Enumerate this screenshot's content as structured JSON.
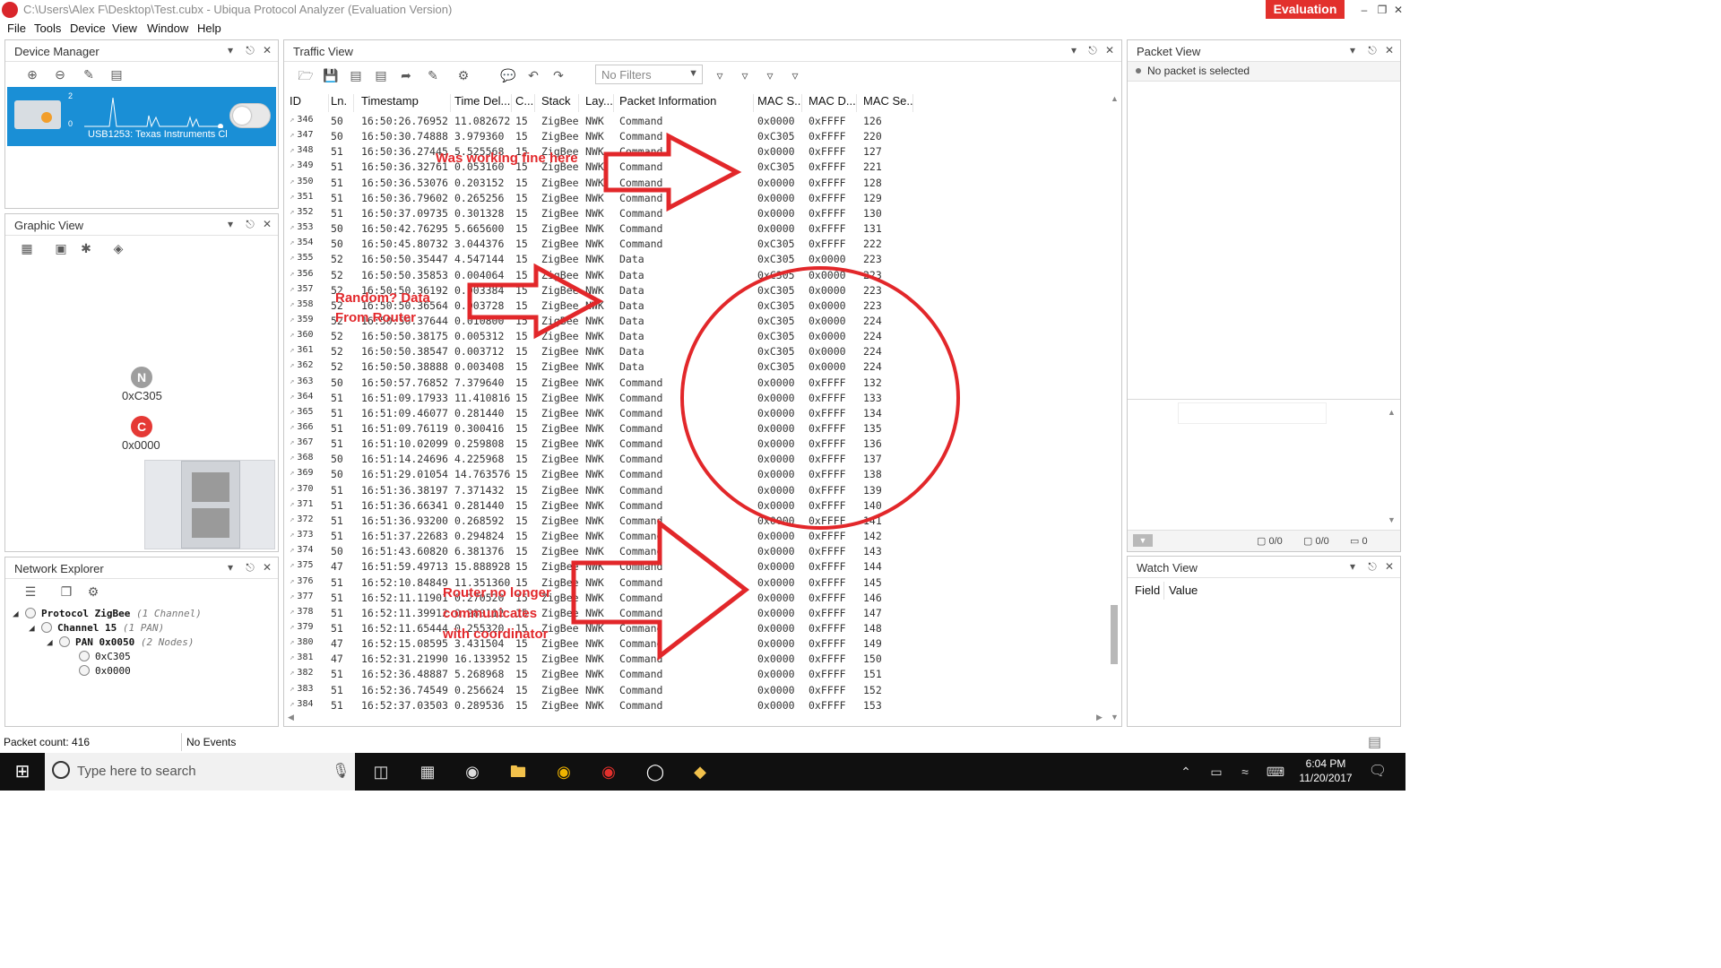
{
  "window": {
    "title": "C:\\Users\\Alex F\\Desktop\\Test.cubx - Ubiqua Protocol Analyzer (Evaluation Version)",
    "evaluation_badge": "Evaluation",
    "minimize": "–",
    "restore": "❐",
    "close": "✕"
  },
  "menu": [
    "File",
    "Tools",
    "Device",
    "View",
    "Window",
    "Help"
  ],
  "device_manager": {
    "title": "Device Manager",
    "device_name": "USB1253: Texas Instruments Cl",
    "sparkline_top": "2",
    "sparkline_bottom": "0"
  },
  "graphic_view": {
    "title": "Graphic View",
    "nodes": [
      {
        "letter": "N",
        "address": "0xC305",
        "color": "#9e9e9e"
      },
      {
        "letter": "C",
        "address": "0x0000",
        "color": "#e53935"
      }
    ]
  },
  "network_explorer": {
    "title": "Network Explorer",
    "protocol": "Protocol ZigBee",
    "protocol_detail": "(1 Channel)",
    "channel": "Channel 15",
    "channel_detail": "(1 PAN)",
    "pan": "PAN 0x0050",
    "pan_detail": "(2 Nodes)",
    "devices": [
      "0xC305",
      "0x0000"
    ]
  },
  "traffic_view": {
    "title": "Traffic View",
    "filter_placeholder": "No Filters",
    "columns": [
      "ID",
      "Ln.",
      "Timestamp",
      "Time Del...",
      "C...",
      "Stack",
      "Lay...",
      "Packet Information",
      "MAC S...",
      "MAC D...",
      "MAC Se..."
    ],
    "rows": [
      [
        "346",
        "50",
        "16:50:26.76952",
        "11.082672",
        "15",
        "ZigBee",
        "NWK",
        "Command",
        "0x0000",
        "0xFFFF",
        "126"
      ],
      [
        "347",
        "50",
        "16:50:30.74888",
        "3.979360",
        "15",
        "ZigBee",
        "NWK",
        "Command",
        "0xC305",
        "0xFFFF",
        "220"
      ],
      [
        "348",
        "51",
        "16:50:36.27445",
        "5.525568",
        "15",
        "ZigBee",
        "NWK",
        "Command",
        "0x0000",
        "0xFFFF",
        "127"
      ],
      [
        "349",
        "51",
        "16:50:36.32761",
        "0.053160",
        "15",
        "ZigBee",
        "NWK",
        "Command",
        "0xC305",
        "0xFFFF",
        "221"
      ],
      [
        "350",
        "51",
        "16:50:36.53076",
        "0.203152",
        "15",
        "ZigBee",
        "NWK",
        "Command",
        "0x0000",
        "0xFFFF",
        "128"
      ],
      [
        "351",
        "51",
        "16:50:36.79602",
        "0.265256",
        "15",
        "ZigBee",
        "NWK",
        "Command",
        "0x0000",
        "0xFFFF",
        "129"
      ],
      [
        "352",
        "51",
        "16:50:37.09735",
        "0.301328",
        "15",
        "ZigBee",
        "NWK",
        "Command",
        "0x0000",
        "0xFFFF",
        "130"
      ],
      [
        "353",
        "50",
        "16:50:42.76295",
        "5.665600",
        "15",
        "ZigBee",
        "NWK",
        "Command",
        "0x0000",
        "0xFFFF",
        "131"
      ],
      [
        "354",
        "50",
        "16:50:45.80732",
        "3.044376",
        "15",
        "ZigBee",
        "NWK",
        "Command",
        "0xC305",
        "0xFFFF",
        "222"
      ],
      [
        "355",
        "52",
        "16:50:50.35447",
        "4.547144",
        "15",
        "ZigBee",
        "NWK",
        "Data",
        "0xC305",
        "0x0000",
        "223"
      ],
      [
        "356",
        "52",
        "16:50:50.35853",
        "0.004064",
        "15",
        "ZigBee",
        "NWK",
        "Data",
        "0xC305",
        "0x0000",
        "223"
      ],
      [
        "357",
        "52",
        "16:50:50.36192",
        "0.003384",
        "15",
        "ZigBee",
        "NWK",
        "Data",
        "0xC305",
        "0x0000",
        "223"
      ],
      [
        "358",
        "52",
        "16:50:50.36564",
        "0.003728",
        "15",
        "ZigBee",
        "NWK",
        "Data",
        "0xC305",
        "0x0000",
        "223"
      ],
      [
        "359",
        "52",
        "16:50:50.37644",
        "0.010800",
        "15",
        "ZigBee",
        "NWK",
        "Data",
        "0xC305",
        "0x0000",
        "224"
      ],
      [
        "360",
        "52",
        "16:50:50.38175",
        "0.005312",
        "15",
        "ZigBee",
        "NWK",
        "Data",
        "0xC305",
        "0x0000",
        "224"
      ],
      [
        "361",
        "52",
        "16:50:50.38547",
        "0.003712",
        "15",
        "ZigBee",
        "NWK",
        "Data",
        "0xC305",
        "0x0000",
        "224"
      ],
      [
        "362",
        "52",
        "16:50:50.38888",
        "0.003408",
        "15",
        "ZigBee",
        "NWK",
        "Data",
        "0xC305",
        "0x0000",
        "224"
      ],
      [
        "363",
        "50",
        "16:50:57.76852",
        "7.379640",
        "15",
        "ZigBee",
        "NWK",
        "Command",
        "0x0000",
        "0xFFFF",
        "132"
      ],
      [
        "364",
        "51",
        "16:51:09.17933",
        "11.410816",
        "15",
        "ZigBee",
        "NWK",
        "Command",
        "0x0000",
        "0xFFFF",
        "133"
      ],
      [
        "365",
        "51",
        "16:51:09.46077",
        "0.281440",
        "15",
        "ZigBee",
        "NWK",
        "Command",
        "0x0000",
        "0xFFFF",
        "134"
      ],
      [
        "366",
        "51",
        "16:51:09.76119",
        "0.300416",
        "15",
        "ZigBee",
        "NWK",
        "Command",
        "0x0000",
        "0xFFFF",
        "135"
      ],
      [
        "367",
        "51",
        "16:51:10.02099",
        "0.259808",
        "15",
        "ZigBee",
        "NWK",
        "Command",
        "0x0000",
        "0xFFFF",
        "136"
      ],
      [
        "368",
        "50",
        "16:51:14.24696",
        "4.225968",
        "15",
        "ZigBee",
        "NWK",
        "Command",
        "0x0000",
        "0xFFFF",
        "137"
      ],
      [
        "369",
        "50",
        "16:51:29.01054",
        "14.763576",
        "15",
        "ZigBee",
        "NWK",
        "Command",
        "0x0000",
        "0xFFFF",
        "138"
      ],
      [
        "370",
        "51",
        "16:51:36.38197",
        "7.371432",
        "15",
        "ZigBee",
        "NWK",
        "Command",
        "0x0000",
        "0xFFFF",
        "139"
      ],
      [
        "371",
        "51",
        "16:51:36.66341",
        "0.281440",
        "15",
        "ZigBee",
        "NWK",
        "Command",
        "0x0000",
        "0xFFFF",
        "140"
      ],
      [
        "372",
        "51",
        "16:51:36.93200",
        "0.268592",
        "15",
        "ZigBee",
        "NWK",
        "Command",
        "0x0000",
        "0xFFFF",
        "141"
      ],
      [
        "373",
        "51",
        "16:51:37.22683",
        "0.294824",
        "15",
        "ZigBee",
        "NWK",
        "Command",
        "0x0000",
        "0xFFFF",
        "142"
      ],
      [
        "374",
        "50",
        "16:51:43.60820",
        "6.381376",
        "15",
        "ZigBee",
        "NWK",
        "Command",
        "0x0000",
        "0xFFFF",
        "143"
      ],
      [
        "375",
        "47",
        "16:51:59.49713",
        "15.888928",
        "15",
        "ZigBee",
        "NWK",
        "Command",
        "0x0000",
        "0xFFFF",
        "144"
      ],
      [
        "376",
        "51",
        "16:52:10.84849",
        "11.351360",
        "15",
        "ZigBee",
        "NWK",
        "Command",
        "0x0000",
        "0xFFFF",
        "145"
      ],
      [
        "377",
        "51",
        "16:52:11.11901",
        "0.270520",
        "15",
        "ZigBee",
        "NWK",
        "Command",
        "0x0000",
        "0xFFFF",
        "146"
      ],
      [
        "378",
        "51",
        "16:52:11.39912",
        "0.280112",
        "15",
        "ZigBee",
        "NWK",
        "Command",
        "0x0000",
        "0xFFFF",
        "147"
      ],
      [
        "379",
        "51",
        "16:52:11.65444",
        "0.255320",
        "15",
        "ZigBee",
        "NWK",
        "Command",
        "0x0000",
        "0xFFFF",
        "148"
      ],
      [
        "380",
        "47",
        "16:52:15.08595",
        "3.431504",
        "15",
        "ZigBee",
        "NWK",
        "Command",
        "0x0000",
        "0xFFFF",
        "149"
      ],
      [
        "381",
        "47",
        "16:52:31.21990",
        "16.133952",
        "15",
        "ZigBee",
        "NWK",
        "Command",
        "0x0000",
        "0xFFFF",
        "150"
      ],
      [
        "382",
        "51",
        "16:52:36.48887",
        "5.268968",
        "15",
        "ZigBee",
        "NWK",
        "Command",
        "0x0000",
        "0xFFFF",
        "151"
      ],
      [
        "383",
        "51",
        "16:52:36.74549",
        "0.256624",
        "15",
        "ZigBee",
        "NWK",
        "Command",
        "0x0000",
        "0xFFFF",
        "152"
      ],
      [
        "384",
        "51",
        "16:52:37.03503",
        "0.289536",
        "15",
        "ZigBee",
        "NWK",
        "Command",
        "0x0000",
        "0xFFFF",
        "153"
      ]
    ]
  },
  "annotations": {
    "top": "Was working fine here",
    "middle": "Random? Data\nFrom Router",
    "bottom": "Router no longer\ncommunicates\nwith coordinator",
    "color": "#e2272a"
  },
  "packet_view": {
    "title": "Packet View",
    "empty_message": "No packet is selected",
    "counter_a": "0/0",
    "counter_b": "0/0",
    "counter_c": "0"
  },
  "watch_view": {
    "title": "Watch View",
    "field_header": "Field",
    "value_header": "Value"
  },
  "status": {
    "packet_count": "Packet count: 416",
    "events": "No Events"
  },
  "taskbar": {
    "search_placeholder": "Type here to search",
    "time": "6:04 PM",
    "date": "11/20/2017"
  }
}
